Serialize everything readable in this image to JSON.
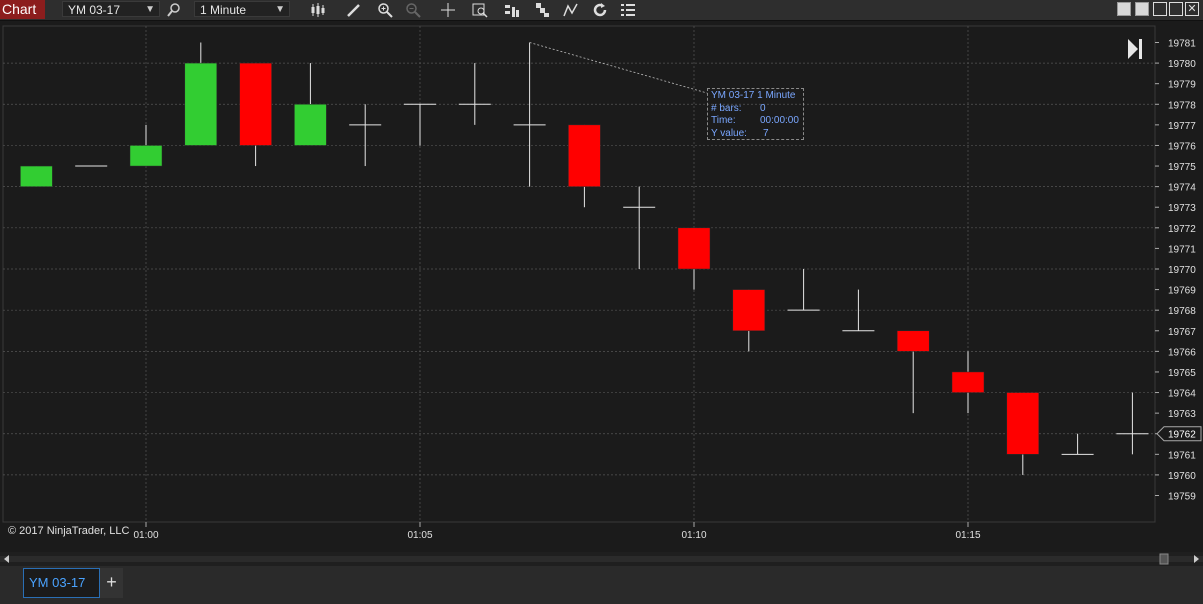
{
  "toolbar": {
    "tab_label": "Chart",
    "instrument": "YM 03-17",
    "interval": "1 Minute"
  },
  "chart": {
    "copyright": "© 2017 NinjaTrader, LLC",
    "tooltip": {
      "title": "YM 03-17 1 Minute",
      "bars_label": "# bars:",
      "bars_value": "0",
      "time_label": "Time:",
      "time_value": "00:00:00",
      "y_label": "Y value:",
      "y_value": "7"
    },
    "current_price_label": "19762"
  },
  "tabs": {
    "instrument_tab": "YM 03-17",
    "add_tab": "+"
  },
  "colors": {
    "up": "#32cd32",
    "down": "#ff0000",
    "background": "#1b1b1b",
    "grid": "#555555"
  },
  "chart_data": {
    "type": "candlestick",
    "ylim": [
      19759,
      19781
    ],
    "yticks": [
      19759,
      19760,
      19761,
      19762,
      19763,
      19764,
      19765,
      19766,
      19767,
      19768,
      19769,
      19770,
      19771,
      19772,
      19773,
      19774,
      19775,
      19776,
      19777,
      19778,
      19779,
      19780,
      19781
    ],
    "x_tick_labels": [
      "01:00",
      "01:05",
      "01:10",
      "01:15"
    ],
    "x_tick_minutes": [
      60,
      65,
      70,
      75
    ],
    "bars": [
      {
        "t": 58,
        "o": 19774,
        "h": 19775,
        "l": 19774,
        "c": 19775
      },
      {
        "t": 59,
        "o": 19775,
        "h": 19775,
        "l": 19775,
        "c": 19775
      },
      {
        "t": 60,
        "o": 19775,
        "h": 19777,
        "l": 19775,
        "c": 19776
      },
      {
        "t": 61,
        "o": 19776,
        "h": 19781,
        "l": 19776,
        "c": 19780
      },
      {
        "t": 62,
        "o": 19780,
        "h": 19780,
        "l": 19775,
        "c": 19776
      },
      {
        "t": 63,
        "o": 19776,
        "h": 19780,
        "l": 19776,
        "c": 19778
      },
      {
        "t": 64,
        "o": 19777,
        "h": 19778,
        "l": 19775,
        "c": 19777
      },
      {
        "t": 65,
        "o": 19778,
        "h": 19778,
        "l": 19776,
        "c": 19778
      },
      {
        "t": 66,
        "o": 19778,
        "h": 19780,
        "l": 19777,
        "c": 19778
      },
      {
        "t": 67,
        "o": 19777,
        "h": 19781,
        "l": 19774,
        "c": 19777
      },
      {
        "t": 68,
        "o": 19777,
        "h": 19777,
        "l": 19773,
        "c": 19774
      },
      {
        "t": 69,
        "o": 19773,
        "h": 19774,
        "l": 19770,
        "c": 19773
      },
      {
        "t": 70,
        "o": 19772,
        "h": 19772,
        "l": 19769,
        "c": 19770
      },
      {
        "t": 71,
        "o": 19769,
        "h": 19769,
        "l": 19766,
        "c": 19767
      },
      {
        "t": 72,
        "o": 19768,
        "h": 19770,
        "l": 19768,
        "c": 19768
      },
      {
        "t": 73,
        "o": 19767,
        "h": 19769,
        "l": 19767,
        "c": 19767
      },
      {
        "t": 74,
        "o": 19767,
        "h": 19767,
        "l": 19763,
        "c": 19766
      },
      {
        "t": 75,
        "o": 19765,
        "h": 19766,
        "l": 19763,
        "c": 19764
      },
      {
        "t": 76,
        "o": 19764,
        "h": 19764,
        "l": 19760,
        "c": 19761
      },
      {
        "t": 77,
        "o": 19761,
        "h": 19762,
        "l": 19761,
        "c": 19761
      },
      {
        "t": 78,
        "o": 19762,
        "h": 19764,
        "l": 19761,
        "c": 19762
      }
    ],
    "last_price": 19762
  }
}
